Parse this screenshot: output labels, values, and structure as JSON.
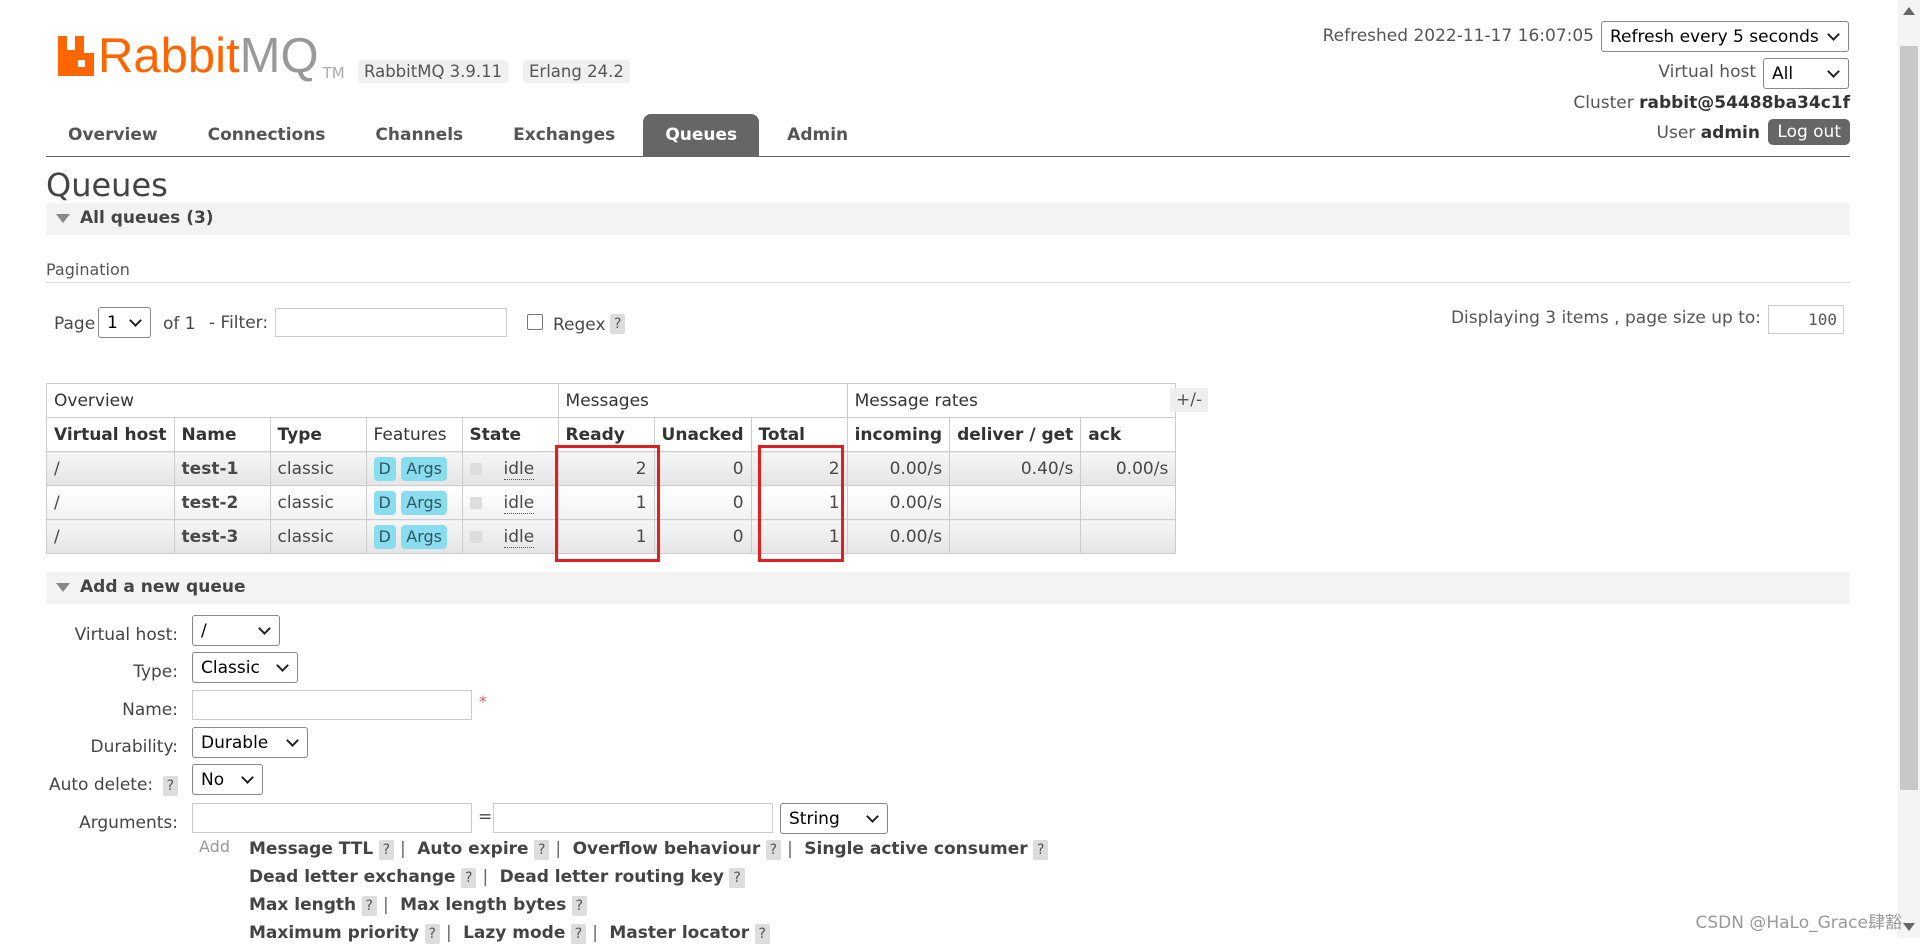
{
  "header": {
    "logo_rabbit": "Rabbit",
    "logo_mq": "MQ",
    "logo_tm": "TM",
    "version_rabbit": "RabbitMQ 3.9.11",
    "version_erlang": "Erlang 24.2",
    "refreshed": "Refreshed 2022-11-17 16:07:05",
    "refresh_select": "Refresh every 5 seconds",
    "vhost_label": "Virtual host",
    "vhost_select": "All",
    "cluster_label": "Cluster",
    "cluster_name": "rabbit@54488ba34c1f",
    "user_label": "User",
    "user_name": "admin",
    "logout": "Log out"
  },
  "tabs": [
    {
      "label": "Overview"
    },
    {
      "label": "Connections"
    },
    {
      "label": "Channels"
    },
    {
      "label": "Exchanges"
    },
    {
      "label": "Queues",
      "active": true
    },
    {
      "label": "Admin"
    }
  ],
  "page_title": "Queues",
  "all_queues": "All queues (3)",
  "pagination": {
    "label": "Pagination",
    "page_label": "Page",
    "page_value": "1",
    "of_label": "of 1",
    "filter_label": "- Filter:",
    "regex_label": "Regex",
    "help": "?",
    "displaying": "Displaying 3 items , page size up to:",
    "page_size": "100"
  },
  "table": {
    "groups": [
      "Overview",
      "Messages",
      "Message rates"
    ],
    "plusminus": "+/-",
    "columns": [
      "Virtual host",
      "Name",
      "Type",
      "Features",
      "State",
      "Ready",
      "Unacked",
      "Total",
      "incoming",
      "deliver / get",
      "ack"
    ],
    "rows": [
      {
        "vhost": "/",
        "name": "test-1",
        "type": "classic",
        "f1": "D",
        "f2": "Args",
        "state": "idle",
        "ready": "2",
        "unacked": "0",
        "total": "2",
        "incoming": "0.00/s",
        "deliver": "0.40/s",
        "ack": "0.00/s"
      },
      {
        "vhost": "/",
        "name": "test-2",
        "type": "classic",
        "f1": "D",
        "f2": "Args",
        "state": "idle",
        "ready": "1",
        "unacked": "0",
        "total": "1",
        "incoming": "0.00/s",
        "deliver": "",
        "ack": ""
      },
      {
        "vhost": "/",
        "name": "test-3",
        "type": "classic",
        "f1": "D",
        "f2": "Args",
        "state": "idle",
        "ready": "1",
        "unacked": "0",
        "total": "1",
        "incoming": "0.00/s",
        "deliver": "",
        "ack": ""
      }
    ]
  },
  "add_queue": {
    "title": "Add a new queue",
    "vhost_label": "Virtual host:",
    "vhost_value": "/",
    "type_label": "Type:",
    "type_value": "Classic",
    "name_label": "Name:",
    "required": "*",
    "durability_label": "Durability:",
    "durability_value": "Durable",
    "autodelete_label": "Auto delete:",
    "autodelete_value": "No",
    "arguments_label": "Arguments:",
    "equals": "=",
    "arg_type": "String",
    "add_label": "Add",
    "help": "?",
    "sep": "|",
    "args_line1": [
      "Message TTL",
      "Auto expire",
      "Overflow behaviour",
      "Single active consumer"
    ],
    "args_line2": [
      "Dead letter exchange",
      "Dead letter routing key"
    ],
    "args_line3": [
      "Max length",
      "Max length bytes"
    ],
    "args_line4": [
      "Maximum priority",
      "Lazy mode",
      "Master locator"
    ]
  },
  "watermark": "CSDN @HaLo_Grace肆豁",
  "colors": {
    "brand": "#ff6600",
    "tab_active": "#666666",
    "highlight": "#e02020",
    "badge": "#88ddee"
  }
}
